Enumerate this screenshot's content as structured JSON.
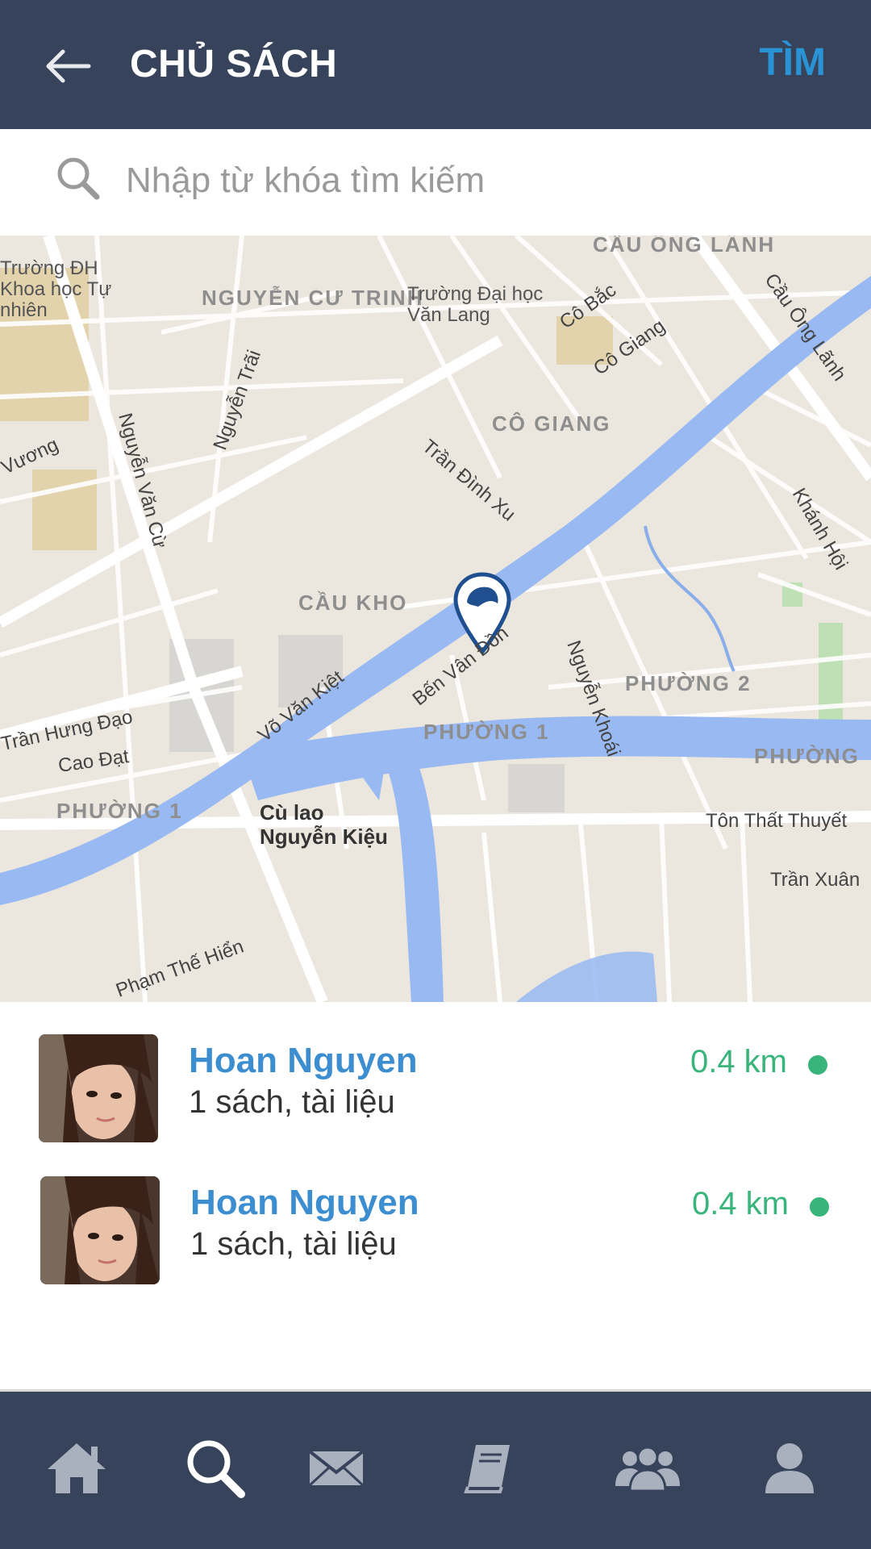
{
  "header": {
    "title": "CHỦ SÁCH",
    "find_label": "TÌM"
  },
  "search": {
    "placeholder": "Nhập từ khóa tìm kiếm",
    "value": ""
  },
  "map": {
    "areas": [
      "NGUYỄN CƯ TRINH",
      "CÔ GIANG",
      "CẦU KHO",
      "PHƯỜNG 2",
      "PHƯỜNG 1",
      "PHƯỜNG 1",
      "PHƯỜNG",
      "CẦU ÔNG LÃNH"
    ],
    "streets": [
      "Võ Văn Kiệt",
      "Bến Vân Đồn",
      "Trần Đình Xu",
      "Nguyễn Khoái",
      "Nguyễn Trãi",
      "Nguyễn Văn Cừ",
      "Cô Bắc",
      "Cô Giang",
      "Cầu Ông Lãnh",
      "Khánh Hội",
      "Tôn Thất Thuyết",
      "Trần Xuân",
      "Phạm Thế Hiển",
      "Cao Đạt",
      "Trần Hưng Đạo",
      "Vương"
    ],
    "places": [
      "Trường ĐH Khoa học Tự nhiên",
      "Trường Đại học Văn Lang",
      "Cù lao Nguyễn Kiệu"
    ]
  },
  "owners": [
    {
      "name": "Hoan Nguyen",
      "subtitle": "1 sách, tài liệu",
      "distance": "0.4 km"
    },
    {
      "name": "Hoan Nguyen",
      "subtitle": "1 sách, tài liệu",
      "distance": "0.4 km"
    }
  ],
  "nav": [
    "home-icon",
    "search-icon",
    "mail-icon",
    "book-icon",
    "group-icon",
    "user-icon"
  ],
  "colors": {
    "header_bg": "#36435a",
    "accent": "#2a93d5",
    "name": "#3d8ed0",
    "distance": "#39b47a",
    "water": "#98b9f2"
  }
}
